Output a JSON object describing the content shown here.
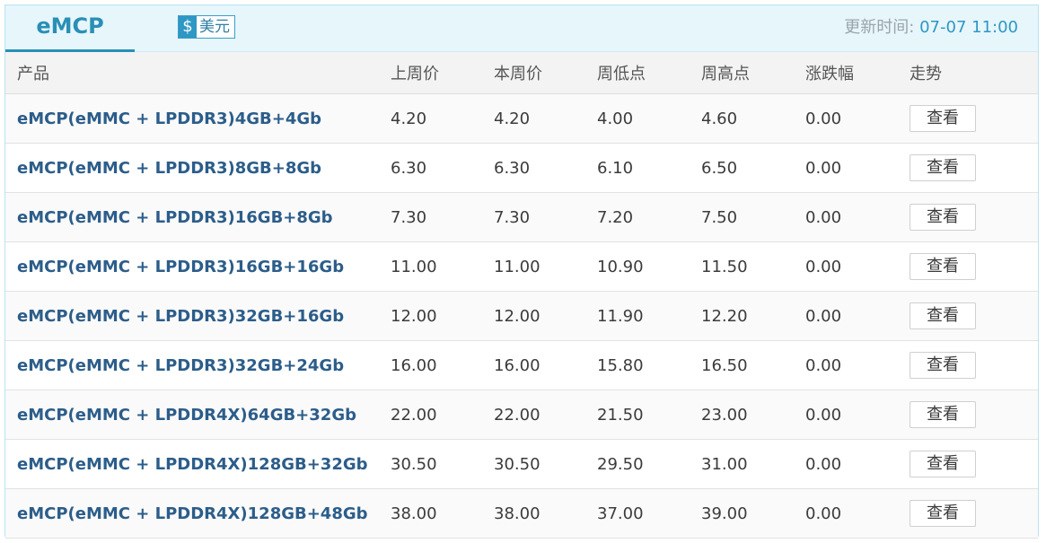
{
  "header": {
    "tab_label": "eMCP",
    "currency_symbol": "$",
    "currency_label": "美元",
    "update_label": "更新时间: ",
    "update_value": "07-07 11:00"
  },
  "table": {
    "columns": [
      "产品",
      "上周价",
      "本周价",
      "周低点",
      "周高点",
      "涨跌幅",
      "走势"
    ],
    "view_label": "查看",
    "rows": [
      {
        "product": "eMCP(eMMC + LPDDR3)4GB+4Gb",
        "last_week": "4.20",
        "this_week": "4.20",
        "weekly_low": "4.00",
        "weekly_high": "4.60",
        "change": "0.00"
      },
      {
        "product": "eMCP(eMMC + LPDDR3)8GB+8Gb",
        "last_week": "6.30",
        "this_week": "6.30",
        "weekly_low": "6.10",
        "weekly_high": "6.50",
        "change": "0.00"
      },
      {
        "product": "eMCP(eMMC + LPDDR3)16GB+8Gb",
        "last_week": "7.30",
        "this_week": "7.30",
        "weekly_low": "7.20",
        "weekly_high": "7.50",
        "change": "0.00"
      },
      {
        "product": "eMCP(eMMC + LPDDR3)16GB+16Gb",
        "last_week": "11.00",
        "this_week": "11.00",
        "weekly_low": "10.90",
        "weekly_high": "11.50",
        "change": "0.00"
      },
      {
        "product": "eMCP(eMMC + LPDDR3)32GB+16Gb",
        "last_week": "12.00",
        "this_week": "12.00",
        "weekly_low": "11.90",
        "weekly_high": "12.20",
        "change": "0.00"
      },
      {
        "product": "eMCP(eMMC + LPDDR3)32GB+24Gb",
        "last_week": "16.00",
        "this_week": "16.00",
        "weekly_low": "15.80",
        "weekly_high": "16.50",
        "change": "0.00"
      },
      {
        "product": "eMCP(eMMC + LPDDR4X)64GB+32Gb",
        "last_week": "22.00",
        "this_week": "22.00",
        "weekly_low": "21.50",
        "weekly_high": "23.00",
        "change": "0.00"
      },
      {
        "product": "eMCP(eMMC + LPDDR4X)128GB+32Gb",
        "last_week": "30.50",
        "this_week": "30.50",
        "weekly_low": "29.50",
        "weekly_high": "31.00",
        "change": "0.00"
      },
      {
        "product": "eMCP(eMMC + LPDDR4X)128GB+48Gb",
        "last_week": "38.00",
        "this_week": "38.00",
        "weekly_low": "37.00",
        "weekly_high": "39.00",
        "change": "0.00"
      }
    ]
  }
}
